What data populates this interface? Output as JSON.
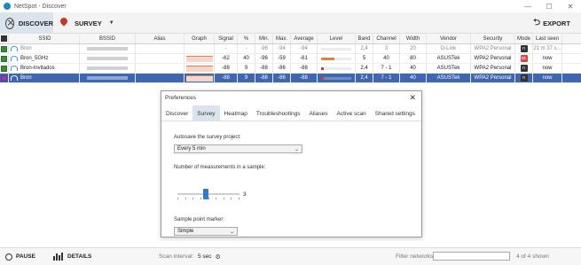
{
  "window": {
    "title": "NetSpot - Discover",
    "controls": [
      "—",
      "☐",
      "✕"
    ]
  },
  "toolbar": {
    "discover_label": "DISCOVER",
    "survey_label": "SURVEY",
    "export_label": "EXPORT"
  },
  "columns": [
    "SSID",
    "BSSID",
    "Alias",
    "Graph",
    "Signal",
    "%",
    "Min.",
    "Max.",
    "Average",
    "Level",
    "Band",
    "Channel",
    "Width",
    "Vendor",
    "Security",
    "Mode",
    "Last seen"
  ],
  "rows": [
    {
      "ssid": "Bron",
      "alias": "",
      "signal": "-",
      "pct": "-",
      "min": "-96",
      "max": "-94",
      "avg": "-94",
      "level": 0.0,
      "level_color": "#cccccc",
      "band": "2,4",
      "channel": "3",
      "width": "20",
      "vendor": "D-Link",
      "security": "WPA2 Personal",
      "mode": "n",
      "mode_color": "#333333",
      "last_seen": "21 m 37 s...",
      "check": "on",
      "dim": true,
      "graph": false,
      "selected": false
    },
    {
      "ssid": "Bron_5GHz",
      "alias": "",
      "signal": "-62",
      "pct": "40",
      "min": "-96",
      "max": "-59",
      "avg": "-61",
      "level": 0.45,
      "level_color": "#e0843a",
      "band": "5",
      "channel": "40",
      "width": "80",
      "vendor": "ASUSTek",
      "security": "WPA2 Personal",
      "mode": "ac",
      "mode_color": "#dd4444",
      "last_seen": "now",
      "check": "on",
      "dim": false,
      "graph": true,
      "selected": false
    },
    {
      "ssid": "Bron-Invitados",
      "alias": "",
      "signal": "-88",
      "pct": "9",
      "min": "-88",
      "max": "-86",
      "avg": "-88",
      "level": 0.1,
      "level_color": "#d33",
      "band": "2,4",
      "channel": "7 - 1",
      "width": "40",
      "vendor": "ASUSTek",
      "security": "WPA2 Personal",
      "mode": "n",
      "mode_color": "#333333",
      "last_seen": "now",
      "check": "on",
      "dim": false,
      "graph": true,
      "selected": false
    },
    {
      "ssid": "Bron",
      "alias": "",
      "signal": "-88",
      "pct": "9",
      "min": "-88",
      "max": "-86",
      "avg": "-88",
      "level": 0.1,
      "level_color": "#d33",
      "band": "2,4",
      "channel": "7 - 1",
      "width": "40",
      "vendor": "ASUSTek",
      "security": "WPA2 Personal",
      "mode": "n",
      "mode_color": "#333333",
      "last_seen": "now",
      "check": "on-purple",
      "dim": false,
      "graph": true,
      "selected": true
    }
  ],
  "preferences": {
    "title": "Preferences",
    "close": "✕",
    "tabs": [
      "Discover",
      "Survey",
      "Heatmap",
      "Troubleshootings",
      "Aliases",
      "Active scan",
      "Shared settings"
    ],
    "active_tab": 1,
    "autosave_label": "Autosave the survey project:",
    "autosave_value": "Every 5 min",
    "measurements_label": "Number of measurements in a sample:",
    "measurements_value": "3",
    "marker_label": "Sample point marker:",
    "marker_value": "Simple"
  },
  "status": {
    "pause_label": "PAUSE",
    "details_label": "DETAILS",
    "scan_interval_label": "Scan interval:",
    "scan_interval_value": "5 sec",
    "filter_label": "Filter networks:",
    "filter_value": "",
    "count_text": "4 of 4 shown"
  }
}
